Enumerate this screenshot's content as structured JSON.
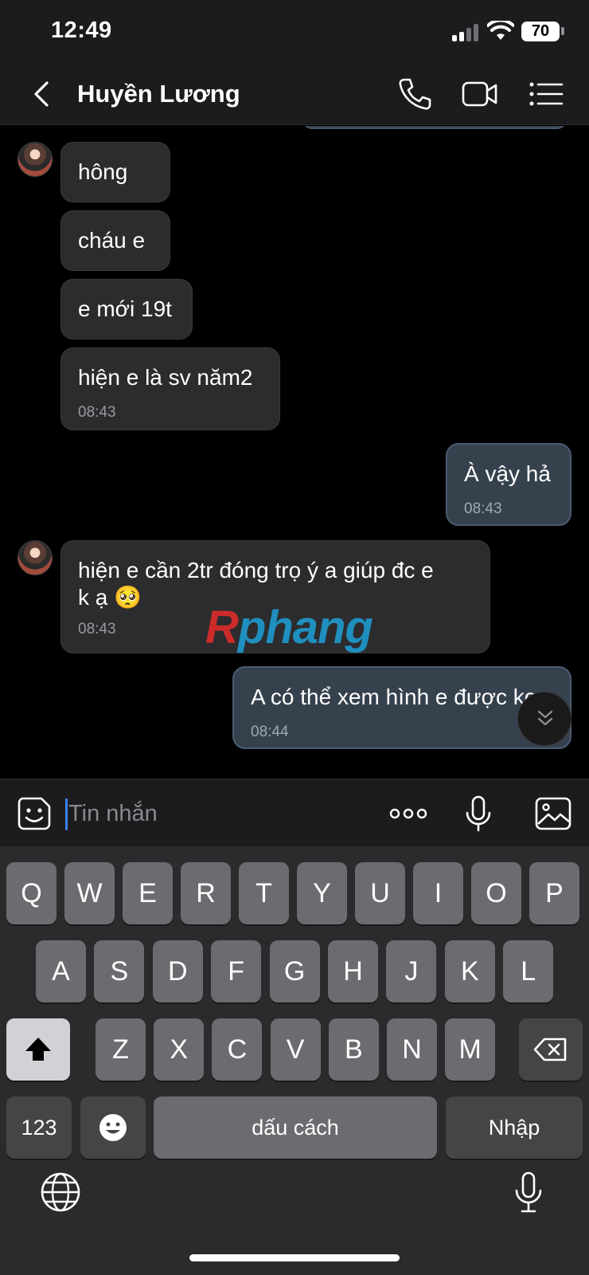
{
  "status_bar": {
    "time": "12:49",
    "battery": "70"
  },
  "header": {
    "contact_name": "Huyền Lương"
  },
  "messages": [
    {
      "direction": "incoming",
      "text": "hông",
      "time": ""
    },
    {
      "direction": "incoming",
      "text": "cháu e",
      "time": ""
    },
    {
      "direction": "incoming",
      "text": "e mới 19t",
      "time": ""
    },
    {
      "direction": "incoming",
      "text": "hiện e là sv năm2",
      "time": "08:43"
    },
    {
      "direction": "outgoing",
      "text": "À vậy hả",
      "time": "08:43"
    },
    {
      "direction": "incoming",
      "text_line1": "hiện e cần 2tr đóng trọ ý a giúp đc e",
      "text_line2": "k ạ 🥺",
      "time": "08:43"
    },
    {
      "direction": "outgoing",
      "text": "A có thể xem hình e được ko",
      "time": "08:44"
    }
  ],
  "watermark": {
    "part1": "R",
    "part2": "phang"
  },
  "input": {
    "placeholder": "Tin nhắn"
  },
  "keyboard": {
    "row1": [
      "Q",
      "W",
      "E",
      "R",
      "T",
      "Y",
      "U",
      "I",
      "O",
      "P"
    ],
    "row2": [
      "A",
      "S",
      "D",
      "F",
      "G",
      "H",
      "J",
      "K",
      "L"
    ],
    "row3": [
      "Z",
      "X",
      "C",
      "V",
      "B",
      "N",
      "M"
    ],
    "numbers_label": "123",
    "space_label": "dấu cách",
    "return_label": "Nhập"
  },
  "icons": {
    "back": "chevron-left-icon",
    "call": "phone-icon",
    "video": "video-camera-icon",
    "menu": "list-icon",
    "sticker": "sticker-face-icon",
    "more": "more-dots-icon",
    "mic": "microphone-icon",
    "image": "image-icon",
    "shift": "shift-arrow-icon",
    "delete": "backspace-icon",
    "emoji": "emoji-icon",
    "globe": "globe-icon",
    "dictation": "microphone-icon"
  },
  "colors": {
    "background": "#000000",
    "incoming_bubble": "#2c2c2e",
    "outgoing_bubble": "#36414e",
    "caret": "#3a82f7",
    "keyboard": "#2b2b2d"
  }
}
